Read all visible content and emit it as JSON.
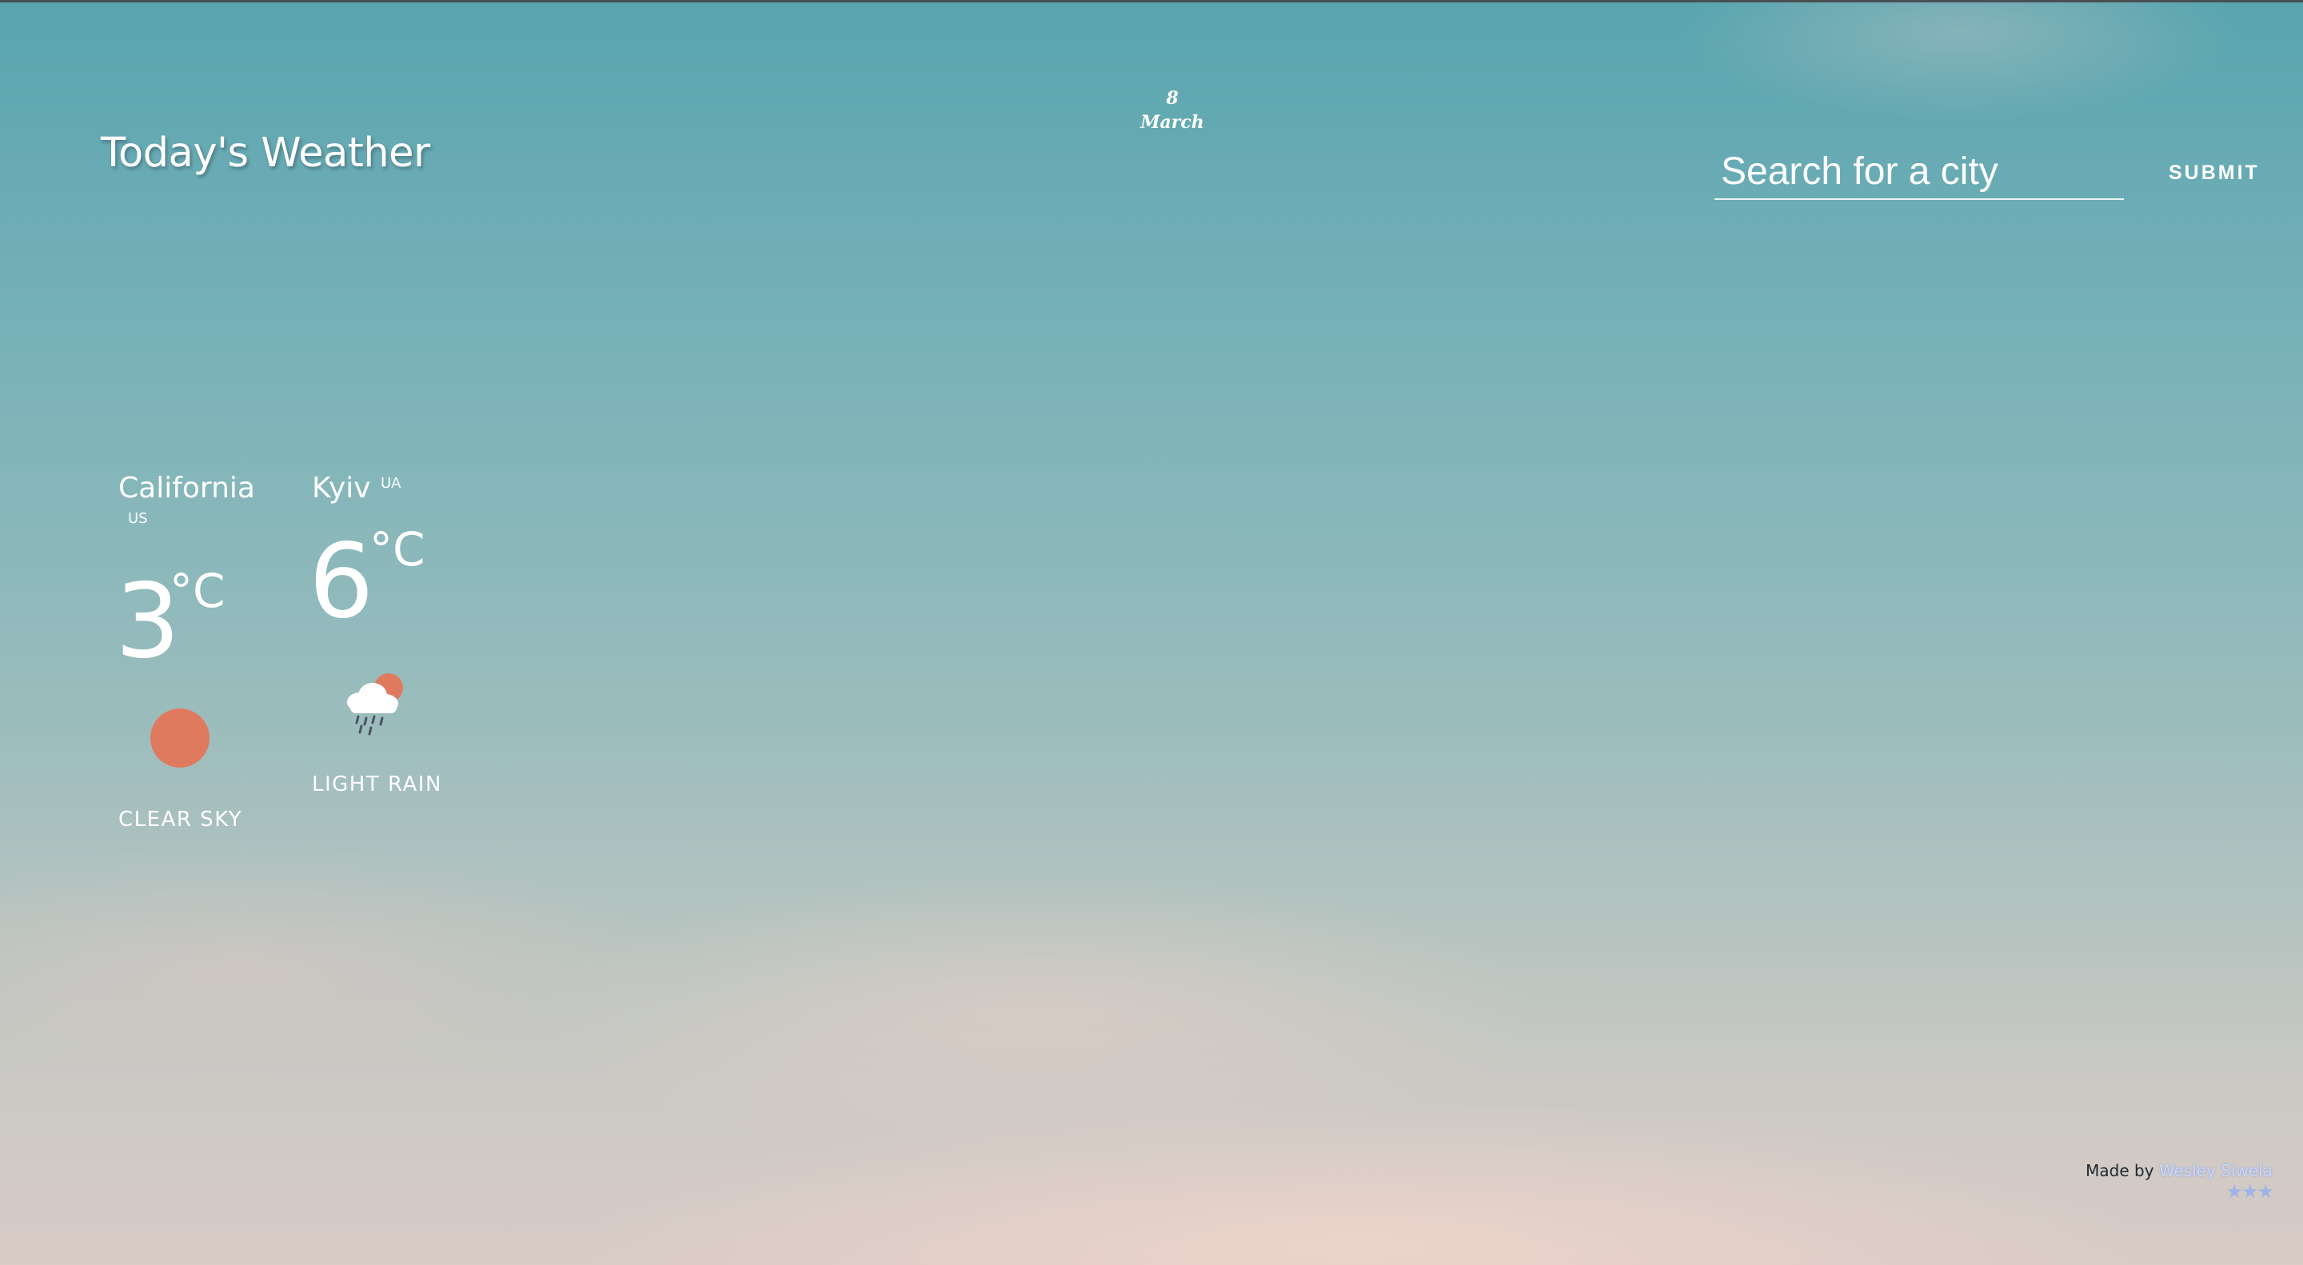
{
  "header": {
    "title": "Today's Weather",
    "date_day": "8",
    "date_month": "March"
  },
  "search": {
    "placeholder": "Search for a city",
    "value": "",
    "submit_label": "SUBMIT"
  },
  "cities": [
    {
      "name": "California",
      "country": "US",
      "temperature": "3",
      "unit": "°C",
      "description": "CLEAR SKY",
      "icon": "sun-icon"
    },
    {
      "name": "Kyiv",
      "country": "UA",
      "temperature": "6",
      "unit": "°C",
      "description": "LIGHT RAIN",
      "icon": "cloud-rain-sun-icon"
    }
  ],
  "footer": {
    "made_by_label": "Made by",
    "author_name": "Wesley Siwela",
    "stars": "★★★"
  },
  "colors": {
    "accent_sun": "#e07a5f",
    "text": "#ffffff",
    "link": "#c7d7ff"
  }
}
